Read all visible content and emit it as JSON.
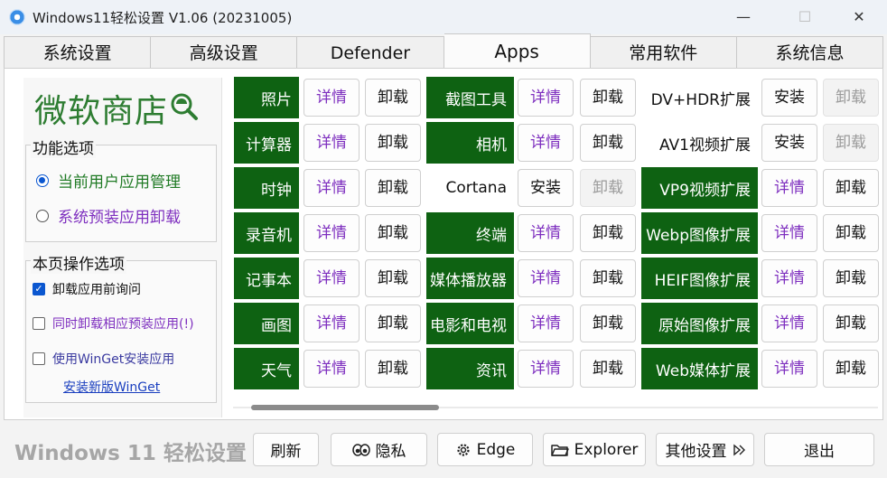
{
  "window": {
    "title": "Windows11轻松设置 V1.06 (20231005)",
    "minimize": "—",
    "maximize": "☐",
    "close": "✕"
  },
  "tabs": [
    "系统设置",
    "高级设置",
    "Defender",
    "Apps",
    "常用软件",
    "系统信息"
  ],
  "active_tab": "Apps",
  "sidebar": {
    "logo_text": "微软商店",
    "function_group": {
      "title": "功能选项",
      "options": [
        {
          "label": "当前用户应用管理",
          "selected": true
        },
        {
          "label": "系统预装应用卸载",
          "selected": false
        }
      ]
    },
    "page_group": {
      "title": "本页操作选项",
      "options": [
        {
          "label": "卸载应用前询问",
          "checked": true
        },
        {
          "label": "同时卸载相应预装应用(!)",
          "checked": false
        },
        {
          "label": "使用WinGet安装应用",
          "checked": false
        }
      ],
      "link": "安装新版WinGet"
    }
  },
  "apps": {
    "col1": [
      {
        "name": "照片",
        "btn1": "详情",
        "btn2": "卸载"
      },
      {
        "name": "计算器",
        "btn1": "详情",
        "btn2": "卸载"
      },
      {
        "name": "时钟",
        "btn1": "详情",
        "btn2": "卸载"
      },
      {
        "name": "录音机",
        "btn1": "详情",
        "btn2": "卸载"
      },
      {
        "name": "记事本",
        "btn1": "详情",
        "btn2": "卸载"
      },
      {
        "name": "画图",
        "btn1": "详情",
        "btn2": "卸载"
      },
      {
        "name": "天气",
        "btn1": "详情",
        "btn2": "卸载"
      }
    ],
    "col2": [
      {
        "name": "截图工具",
        "btn1": "详情",
        "btn2": "卸载"
      },
      {
        "name": "相机",
        "btn1": "详情",
        "btn2": "卸载"
      },
      {
        "name": "Cortana",
        "btn1": "安装",
        "btn2": "卸载"
      },
      {
        "name": "终端",
        "btn1": "详情",
        "btn2": "卸载"
      },
      {
        "name": "媒体播放器",
        "btn1": "详情",
        "btn2": "卸载"
      },
      {
        "name": "电影和电视",
        "btn1": "详情",
        "btn2": "卸载"
      },
      {
        "name": "资讯",
        "btn1": "详情",
        "btn2": "卸载"
      }
    ],
    "col3": [
      {
        "name": "DV+HDR扩展",
        "btn1": "安装",
        "btn2": "卸载"
      },
      {
        "name": "AV1视频扩展",
        "btn1": "安装",
        "btn2": "卸载"
      },
      {
        "name": "VP9视频扩展",
        "btn1": "详情",
        "btn2": "卸载"
      },
      {
        "name": "Webp图像扩展",
        "btn1": "详情",
        "btn2": "卸载"
      },
      {
        "name": "HEIF图像扩展",
        "btn1": "详情",
        "btn2": "卸载"
      },
      {
        "name": "原始图像扩展",
        "btn1": "详情",
        "btn2": "卸载"
      },
      {
        "name": "Web媒体扩展",
        "btn1": "详情",
        "btn2": "卸载"
      }
    ]
  },
  "footer": {
    "brand": "Windows 11 轻松设置",
    "buttons": {
      "refresh": "刷新",
      "privacy": "隐私",
      "edge": "Edge",
      "explorer": "Explorer",
      "more": "其他设置",
      "exit": "退出"
    }
  },
  "colors": {
    "installed_green": "#0e6212",
    "detail_purple": "#7e2fbf",
    "logo_green": "#2e7d32",
    "accent_blue": "#0b57d0"
  }
}
